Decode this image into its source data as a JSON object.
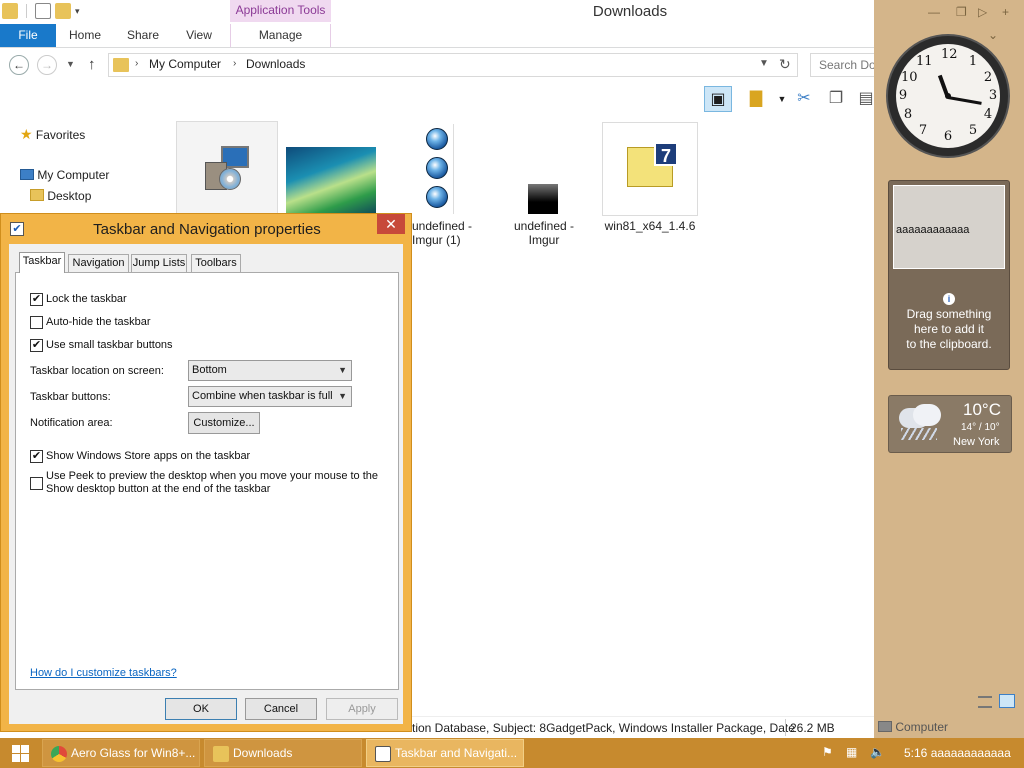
{
  "explorer": {
    "window_title": "Downloads",
    "contextual_tab_group": "Application Tools",
    "ribbon_tabs": {
      "file": "File",
      "home": "Home",
      "share": "Share",
      "view": "View",
      "manage": "Manage"
    },
    "address": {
      "segments": [
        "My Computer",
        "Downloads"
      ]
    },
    "search_placeholder": "Search Downloads",
    "nav_pane": {
      "favorites": "Favorites",
      "my_computer": "My Computer",
      "desktop": "Desktop"
    },
    "files": [
      {
        "name": "undefined - Imgur (1)"
      },
      {
        "name": "undefined - Imgur"
      },
      {
        "name": "win81_x64_1.4.6"
      }
    ],
    "status": {
      "details": "tion Database, Subject: 8GadgetPack, Windows Installer Package, Date",
      "size": "26.2 MB",
      "computer": "Computer"
    }
  },
  "dialog": {
    "title": "Taskbar and Navigation properties",
    "tabs": [
      "Taskbar",
      "Navigation",
      "Jump Lists",
      "Toolbars"
    ],
    "active_tab": "Taskbar",
    "checkboxes": {
      "lock": {
        "label": "Lock the taskbar",
        "checked": true
      },
      "autohide": {
        "label": "Auto-hide the taskbar",
        "checked": false
      },
      "small": {
        "label": "Use small taskbar buttons",
        "checked": true
      },
      "store": {
        "label": "Show Windows Store apps on the taskbar",
        "checked": true
      },
      "peek_line1": "Use Peek to preview the desktop when you move your mouse to the",
      "peek_line2": "Show desktop button at the end of the taskbar",
      "peek_checked": false
    },
    "fields": {
      "location_label": "Taskbar location on screen:",
      "location_value": "Bottom",
      "buttons_label": "Taskbar buttons:",
      "buttons_value": "Combine when taskbar is full",
      "notification_label": "Notification area:",
      "customize": "Customize..."
    },
    "help_link": "How do I customize taskbars?",
    "buttons": {
      "ok": "OK",
      "cancel": "Cancel",
      "apply": "Apply"
    }
  },
  "sidebar": {
    "clock": {
      "numbers": [
        "12",
        "1",
        "2",
        "3",
        "4",
        "5",
        "6",
        "7",
        "8",
        "9",
        "10",
        "11"
      ],
      "time": "5:16"
    },
    "clipboard": {
      "content": "aaaaaaaaaaaa",
      "hint_lines": [
        "Drag something",
        "here to add it",
        "to the clipboard."
      ]
    },
    "weather": {
      "temp": "10°C",
      "hilo": "14° / 10°",
      "city": "New York"
    }
  },
  "taskbar": {
    "buttons": [
      {
        "label": "Aero Glass for Win8+...",
        "icon_color": "#e04a3a"
      },
      {
        "label": "Downloads",
        "icon_color": "#e8c35a"
      },
      {
        "label": "Taskbar and Navigati...",
        "icon_color": "#ffffff"
      }
    ],
    "tray_text": "5:16 aaaaaaaaaaaa"
  }
}
